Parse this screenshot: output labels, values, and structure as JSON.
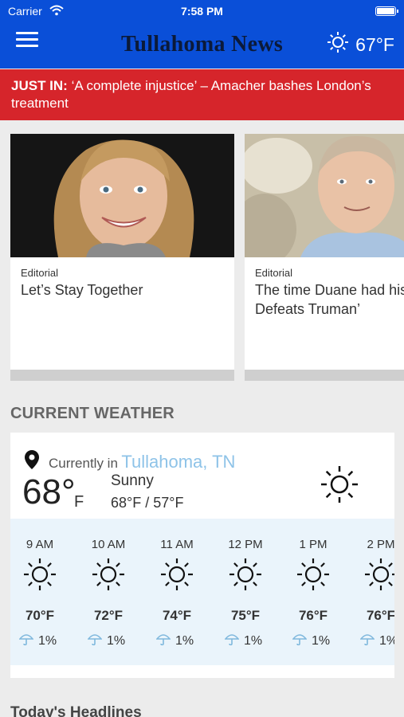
{
  "status": {
    "carrier": "Carrier",
    "time": "7:58 PM"
  },
  "header": {
    "title": "Tullahoma News",
    "temperature": "67°F",
    "weather_icon": "sun-icon"
  },
  "breaking": {
    "label": "JUST IN:",
    "text": "‘A complete injustice’ – Amacher bashes London’s treatment"
  },
  "articles": [
    {
      "category": "Editorial",
      "title": "Let’s Stay Together"
    },
    {
      "category": "Editorial",
      "title": "The time Duane had his ‘Dewey Defeats Truman’"
    }
  ],
  "weather_section": {
    "heading": "CURRENT WEATHER",
    "currently_in": "Currently in",
    "city": "Tullahoma, TN",
    "temp": "68°",
    "unit": "F",
    "condition": "Sunny",
    "hi_lo": "68°F / 57°F",
    "hourly": [
      {
        "hour": "9 AM",
        "temp": "70°F",
        "precip": "1%"
      },
      {
        "hour": "10 AM",
        "temp": "72°F",
        "precip": "1%"
      },
      {
        "hour": "11 AM",
        "temp": "74°F",
        "precip": "1%"
      },
      {
        "hour": "12 PM",
        "temp": "75°F",
        "precip": "1%"
      },
      {
        "hour": "1 PM",
        "temp": "76°F",
        "precip": "1%"
      },
      {
        "hour": "2 PM",
        "temp": "76°F",
        "precip": "1%"
      }
    ]
  },
  "headlines_heading": "Today's Headlines",
  "colors": {
    "brand_blue": "#0a4fd8",
    "breaking_red": "#d6252b",
    "city_blue": "#8ec3e8",
    "hourly_bg": "#eaf4fb"
  }
}
